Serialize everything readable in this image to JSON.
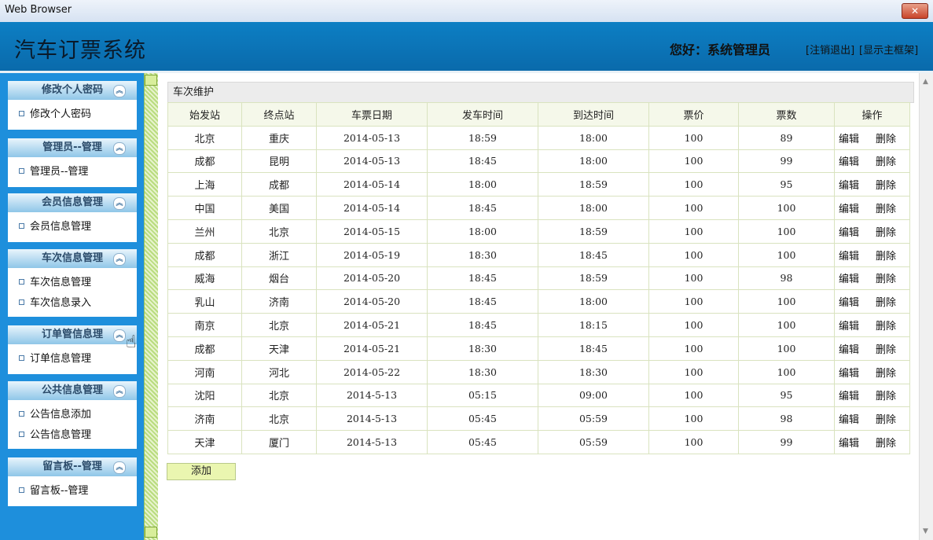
{
  "window": {
    "title": "Web Browser",
    "close_label": "✕"
  },
  "header": {
    "system_title": "汽车订票系统",
    "greeting": "您好：系统管理员",
    "logout_link": "[注销退出]",
    "frame_link": "[显示主框架]"
  },
  "sidebar": {
    "groups": [
      {
        "title": "修改个人密码",
        "items": [
          "修改个人密码"
        ]
      },
      {
        "title": "管理员--管理",
        "items": [
          "管理员--管理"
        ]
      },
      {
        "title": "会员信息管理",
        "items": [
          "会员信息管理"
        ]
      },
      {
        "title": "车次信息管理",
        "items": [
          "车次信息管理",
          "车次信息录入"
        ]
      },
      {
        "title": "订单管信息理",
        "items": [
          "订单信息管理"
        ]
      },
      {
        "title": "公共信息管理",
        "items": [
          "公告信息添加",
          "公告信息管理"
        ]
      },
      {
        "title": "留言板--管理",
        "items": [
          "留言板--管理"
        ]
      }
    ]
  },
  "main": {
    "panel_title": "车次维护",
    "columns": [
      "始发站",
      "终点站",
      "车票日期",
      "发车时间",
      "到达时间",
      "票价",
      "票数",
      "操作"
    ],
    "rows": [
      [
        "北京",
        "重庆",
        "2014-05-13",
        "18:59",
        "18:00",
        "100",
        "89"
      ],
      [
        "成都",
        "昆明",
        "2014-05-13",
        "18:45",
        "18:00",
        "100",
        "99"
      ],
      [
        "上海",
        "成都",
        "2014-05-14",
        "18:00",
        "18:59",
        "100",
        "95"
      ],
      [
        "中国",
        "美国",
        "2014-05-14",
        "18:45",
        "18:00",
        "100",
        "100"
      ],
      [
        "兰州",
        "北京",
        "2014-05-15",
        "18:00",
        "18:59",
        "100",
        "100"
      ],
      [
        "成都",
        "浙江",
        "2014-05-19",
        "18:30",
        "18:45",
        "100",
        "100"
      ],
      [
        "威海",
        "烟台",
        "2014-05-20",
        "18:45",
        "18:59",
        "100",
        "98"
      ],
      [
        "乳山",
        "济南",
        "2014-05-20",
        "18:45",
        "18:00",
        "100",
        "100"
      ],
      [
        "南京",
        "北京",
        "2014-05-21",
        "18:45",
        "18:15",
        "100",
        "100"
      ],
      [
        "成都",
        "天津",
        "2014-05-21",
        "18:30",
        "18:45",
        "100",
        "100"
      ],
      [
        "河南",
        "河北",
        "2014-05-22",
        "18:30",
        "18:30",
        "100",
        "100"
      ],
      [
        "沈阳",
        "北京",
        "2014-5-13",
        "05:15",
        "09:00",
        "100",
        "95"
      ],
      [
        "济南",
        "北京",
        "2014-5-13",
        "05:45",
        "05:59",
        "100",
        "98"
      ],
      [
        "天津",
        "厦门",
        "2014-5-13",
        "05:45",
        "05:59",
        "100",
        "99"
      ]
    ],
    "edit_label": "编辑",
    "delete_label": "删除",
    "add_label": "添加"
  },
  "icons": {
    "toggle": "collapse-up-icon",
    "bullet": "square-bullet-icon",
    "cursor": "hand-pointer-icon"
  },
  "colors": {
    "banner": "#0d7fc4",
    "sidebar": "#1e8fdc",
    "splitter": "#b9dc7e"
  }
}
